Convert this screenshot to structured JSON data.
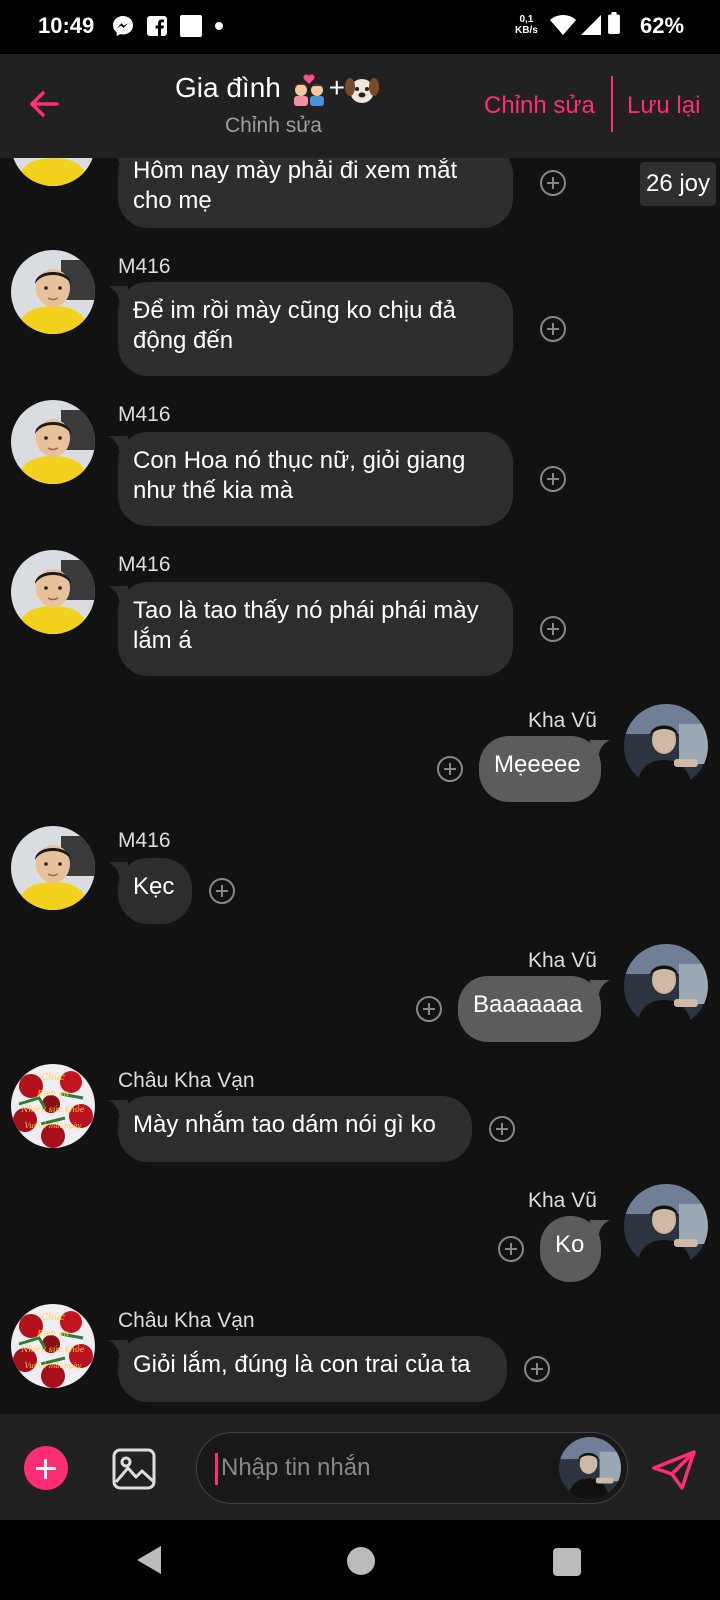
{
  "status_bar": {
    "time": "10:49",
    "speed_value": "0,1",
    "speed_unit": "KB/s",
    "battery": "62%",
    "icons": [
      "messenger-icon",
      "facebook-icon",
      "square-notification-icon",
      "dot-icon",
      "wifi-icon",
      "signal-icon",
      "battery-icon"
    ]
  },
  "header": {
    "title": "Gia đình",
    "title_emoji": [
      "couple-with-heart-emoji",
      "plus",
      "dog-face-emoji"
    ],
    "subtitle": "Chỉnh sửa",
    "edit_label": "Chỉnh sửa",
    "save_label": "Lưu lại",
    "accent_color": "#ff2e74"
  },
  "side_badge": "26 joy",
  "messages": [
    {
      "sender": "",
      "text": "Hôm nay mày phải đi xem mắt\ncho mẹ",
      "mine": false,
      "avatar": "boy-yellow"
    },
    {
      "sender": "M416",
      "text": "Để im rồi mày cũng ko chịu đả\nđộng đến",
      "mine": false,
      "avatar": "boy-yellow"
    },
    {
      "sender": "M416",
      "text": "Con Hoa nó thục nữ, giỏi giang\nnhư thế kia mà",
      "mine": false,
      "avatar": "boy-yellow"
    },
    {
      "sender": "M416",
      "text": "Tao là tao thấy nó phái phái mày\nlắm á",
      "mine": false,
      "avatar": "boy-yellow"
    },
    {
      "sender": "Kha Vũ",
      "text": "Mẹeeee",
      "mine": true,
      "avatar": "man-dark"
    },
    {
      "sender": "M416",
      "text": "Kẹc",
      "mine": false,
      "avatar": "boy-yellow"
    },
    {
      "sender": "Kha Vũ",
      "text": "Baaaaaaa",
      "mine": true,
      "avatar": "man-dark"
    },
    {
      "sender": "Châu Kha Vạn",
      "text": "Mày nhắm tao dám nói gì ko",
      "mine": false,
      "avatar": "roses"
    },
    {
      "sender": "Kha Vũ",
      "text": "Ko",
      "mine": true,
      "avatar": "man-dark"
    },
    {
      "sender": "Châu Kha Vạn",
      "text": "Giỏi lắm, đúng là con trai của ta",
      "mine": false,
      "avatar": "roses"
    }
  ],
  "composer": {
    "placeholder": "Nhập tin nhắn",
    "value": ""
  }
}
